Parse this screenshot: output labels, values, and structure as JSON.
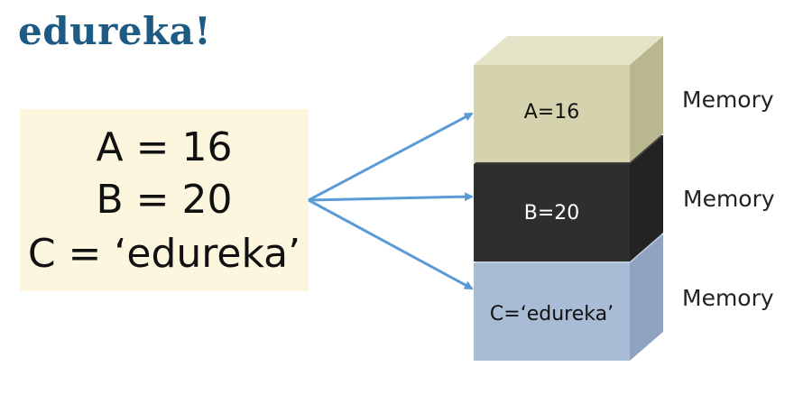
{
  "logo": {
    "text": "edureka!",
    "color": "#1d5b85"
  },
  "variables": {
    "line_a": "A = 16",
    "line_b": "B = 20",
    "line_c": "C = ‘edureka’",
    "box_color": "#fdf6df"
  },
  "blocks": [
    {
      "label": "A=16",
      "memory_label": "Memory",
      "front_color": "#d4d3ad",
      "top_color": "#e5e4c8",
      "side_color": "#b8b78f",
      "text_color": "#111111"
    },
    {
      "label": "B=20",
      "memory_label": "Memory",
      "front_color": "#2e2e2c",
      "top_color": "#3b3b38",
      "side_color": "#232321",
      "text_color": "#ffffff"
    },
    {
      "label": "C=‘edureka’",
      "memory_label": "Memory",
      "front_color": "#a9bcd6",
      "top_color": "#bccadf",
      "side_color": "#8fa3bf",
      "text_color": "#111111"
    }
  ],
  "arrow_color": "#5b9bd5"
}
